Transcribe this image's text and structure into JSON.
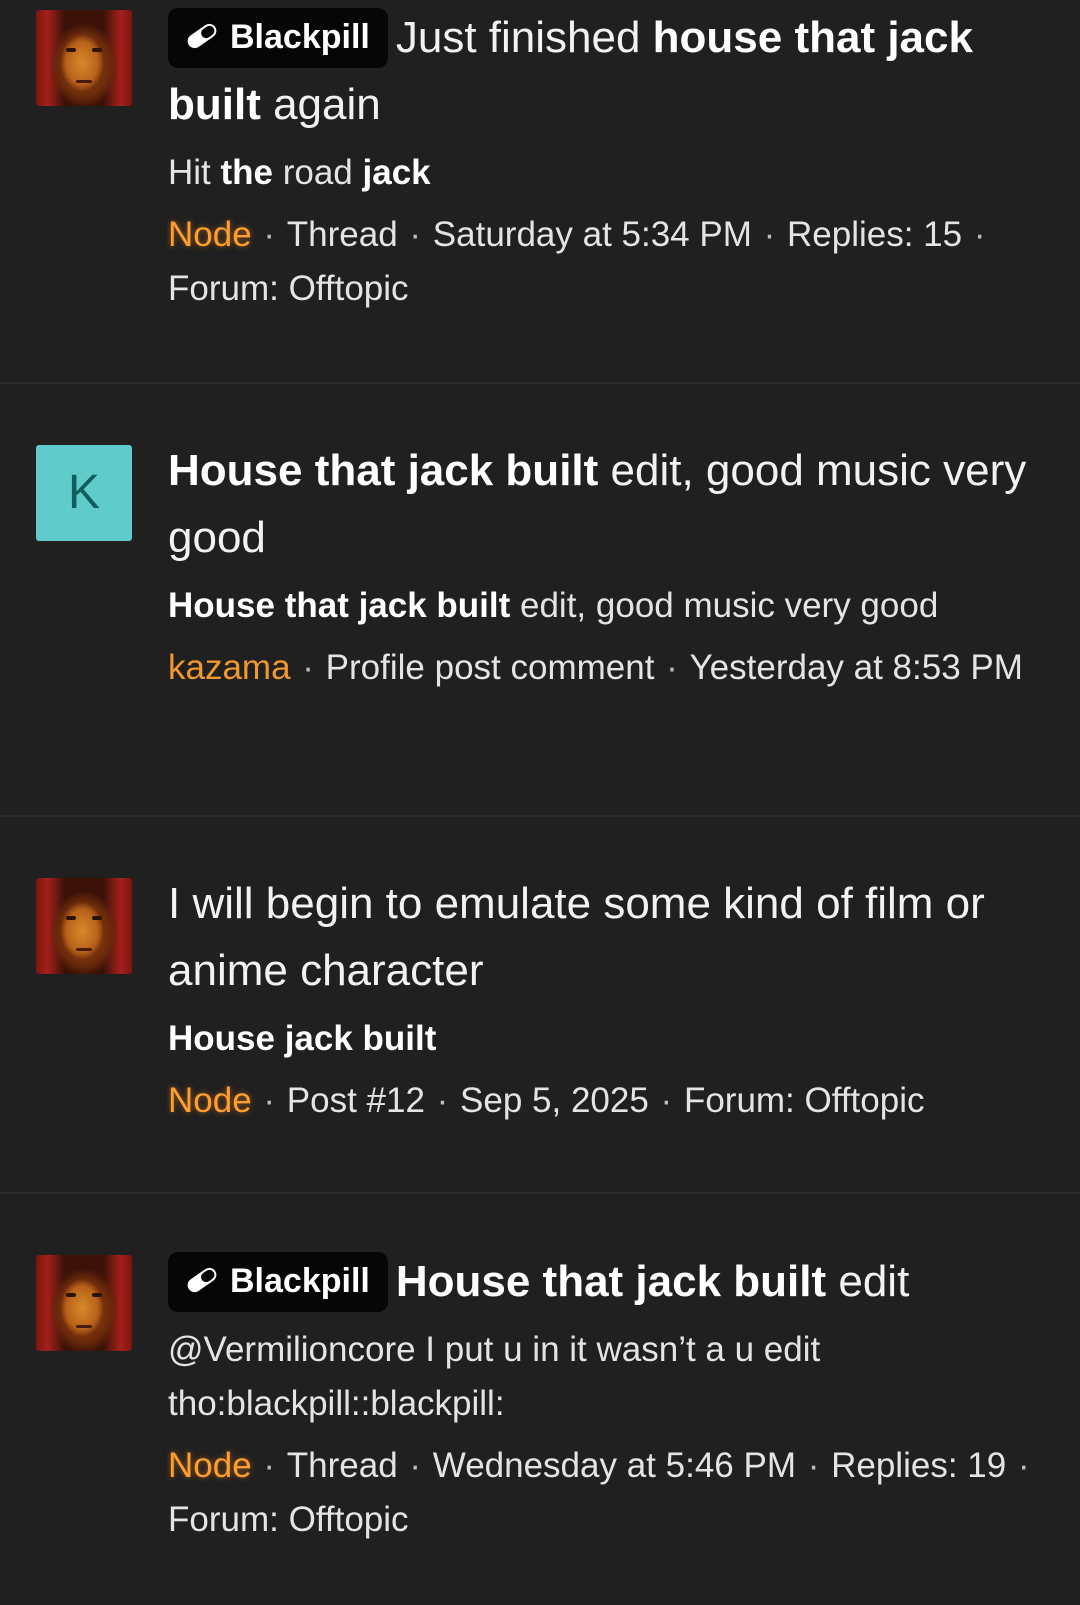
{
  "colors": {
    "background": "#202020",
    "divider": "#2b2b2b",
    "username": "#ff9d2e",
    "badge_bg": "#060606",
    "letter_avatar_bg": "#5fcccb"
  },
  "results": [
    {
      "avatar": {
        "type": "photo",
        "icon": "user-photo-avatar"
      },
      "badge": "Blackpill",
      "title_parts": [
        {
          "text": "Just finished ",
          "bold": false
        },
        {
          "text": "house that jack built",
          "bold": true
        },
        {
          "text": " again",
          "bold": false
        }
      ],
      "snippet_parts": [
        {
          "text": "Hit ",
          "bold": false
        },
        {
          "text": "the",
          "bold": true
        },
        {
          "text": " road ",
          "bold": false
        },
        {
          "text": "jack",
          "bold": true
        }
      ],
      "meta": {
        "user": "Node",
        "rest": [
          "Thread",
          "Saturday at 5:34 PM",
          "Replies: 15",
          "Forum: Offtopic"
        ]
      }
    },
    {
      "avatar": {
        "type": "letter",
        "letter": "K"
      },
      "badge": "",
      "title_parts": [
        {
          "text": "House that jack built",
          "bold": true
        },
        {
          "text": " edit, good music very good",
          "bold": false
        }
      ],
      "snippet_parts": [
        {
          "text": "House that jack built",
          "bold": true
        },
        {
          "text": " edit, good music very good",
          "bold": false
        }
      ],
      "meta": {
        "user": "kazama",
        "rest": [
          "Profile post comment",
          "Yesterday at 8:53 PM"
        ]
      }
    },
    {
      "avatar": {
        "type": "photo",
        "icon": "user-photo-avatar"
      },
      "badge": "",
      "title_parts": [
        {
          "text": "I will begin to emulate some kind of film or anime character",
          "bold": false
        }
      ],
      "snippet_parts": [
        {
          "text": "House jack built",
          "bold": true
        }
      ],
      "meta": {
        "user": "Node",
        "rest": [
          "Post #12",
          "Sep 5, 2025",
          "Forum: Offtopic"
        ]
      }
    },
    {
      "avatar": {
        "type": "photo",
        "icon": "user-photo-avatar"
      },
      "badge": "Blackpill",
      "title_parts": [
        {
          "text": "House that jack built",
          "bold": true
        },
        {
          "text": " edit",
          "bold": false
        }
      ],
      "snippet_parts": [
        {
          "text": "@Vermilioncore I put u in it wasn’t a u edit tho:blackpill::blackpill:",
          "bold": false
        }
      ],
      "meta": {
        "user": "Node",
        "rest": [
          "Thread",
          "Wednesday at 5:46 PM",
          "Replies: 19",
          "Forum: Offtopic"
        ]
      }
    }
  ]
}
